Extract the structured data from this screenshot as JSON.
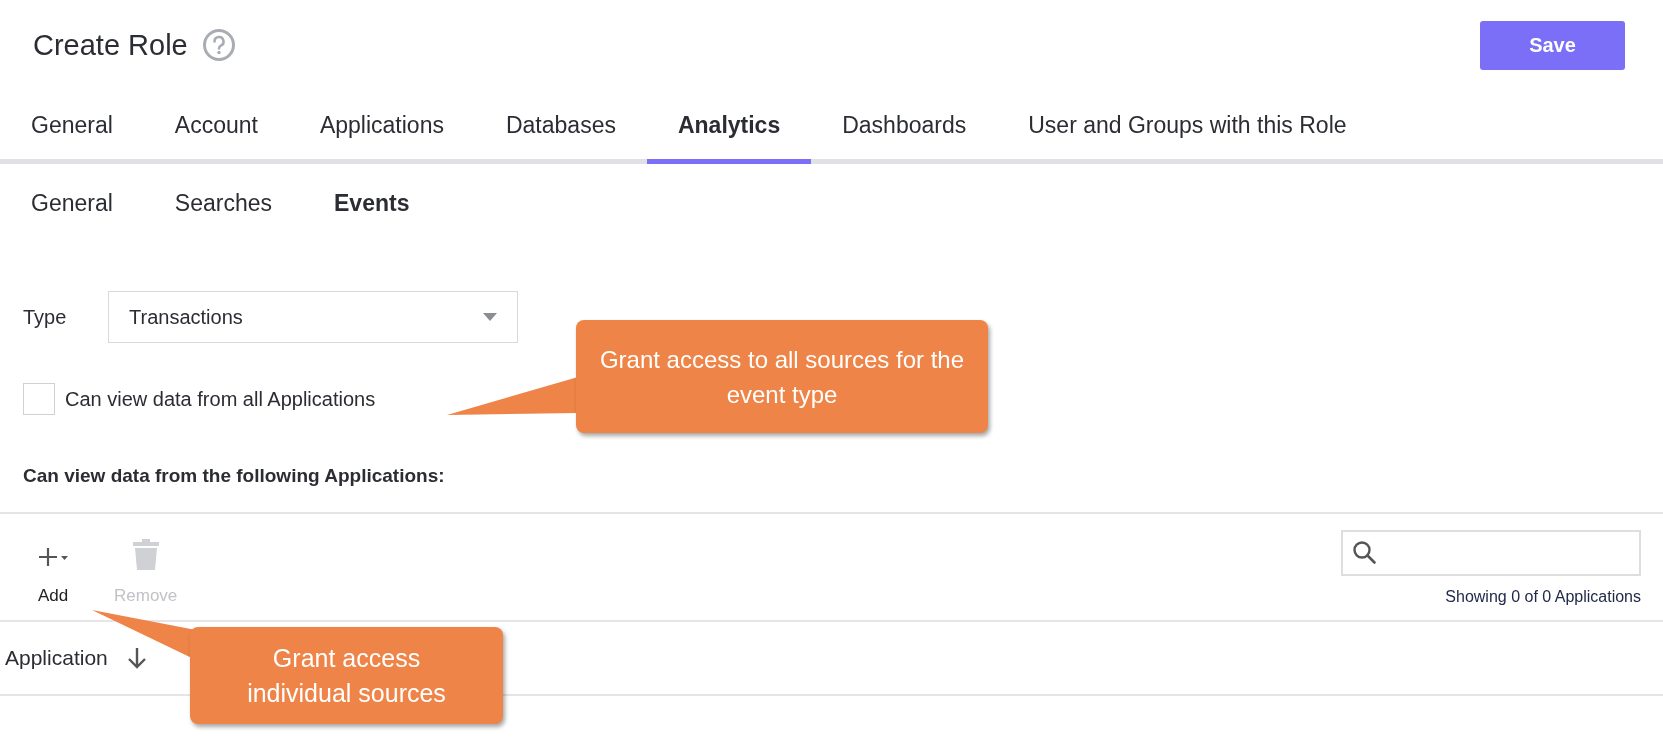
{
  "page": {
    "title": "Create Role",
    "save_button": "Save"
  },
  "tabs": [
    {
      "label": "General",
      "selected": false
    },
    {
      "label": "Account",
      "selected": false
    },
    {
      "label": "Applications",
      "selected": false
    },
    {
      "label": "Databases",
      "selected": false
    },
    {
      "label": "Analytics",
      "selected": true
    },
    {
      "label": "Dashboards",
      "selected": false
    },
    {
      "label": "User and Groups with this Role",
      "selected": false
    }
  ],
  "subtabs": [
    {
      "label": "General",
      "selected": false
    },
    {
      "label": "Searches",
      "selected": false
    },
    {
      "label": "Events",
      "selected": true
    }
  ],
  "type_field": {
    "label": "Type",
    "value": "Transactions"
  },
  "all_applications": {
    "label": "Can view data from all Applications",
    "checked": false
  },
  "section_heading": "Can view data from the following Applications:",
  "toolbar": [
    {
      "label": "Add",
      "kind": "add",
      "disabled": false
    },
    {
      "label": "Remove",
      "kind": "remove",
      "disabled": true
    }
  ],
  "results_count": "Showing 0 of 0 Applications",
  "table": {
    "columns": [
      "Application"
    ]
  },
  "callouts": [
    {
      "text": "Grant access to all sources for the event type",
      "kind": "checkbox"
    },
    {
      "text": "Grant access individual sources",
      "kind": "add"
    }
  ]
}
